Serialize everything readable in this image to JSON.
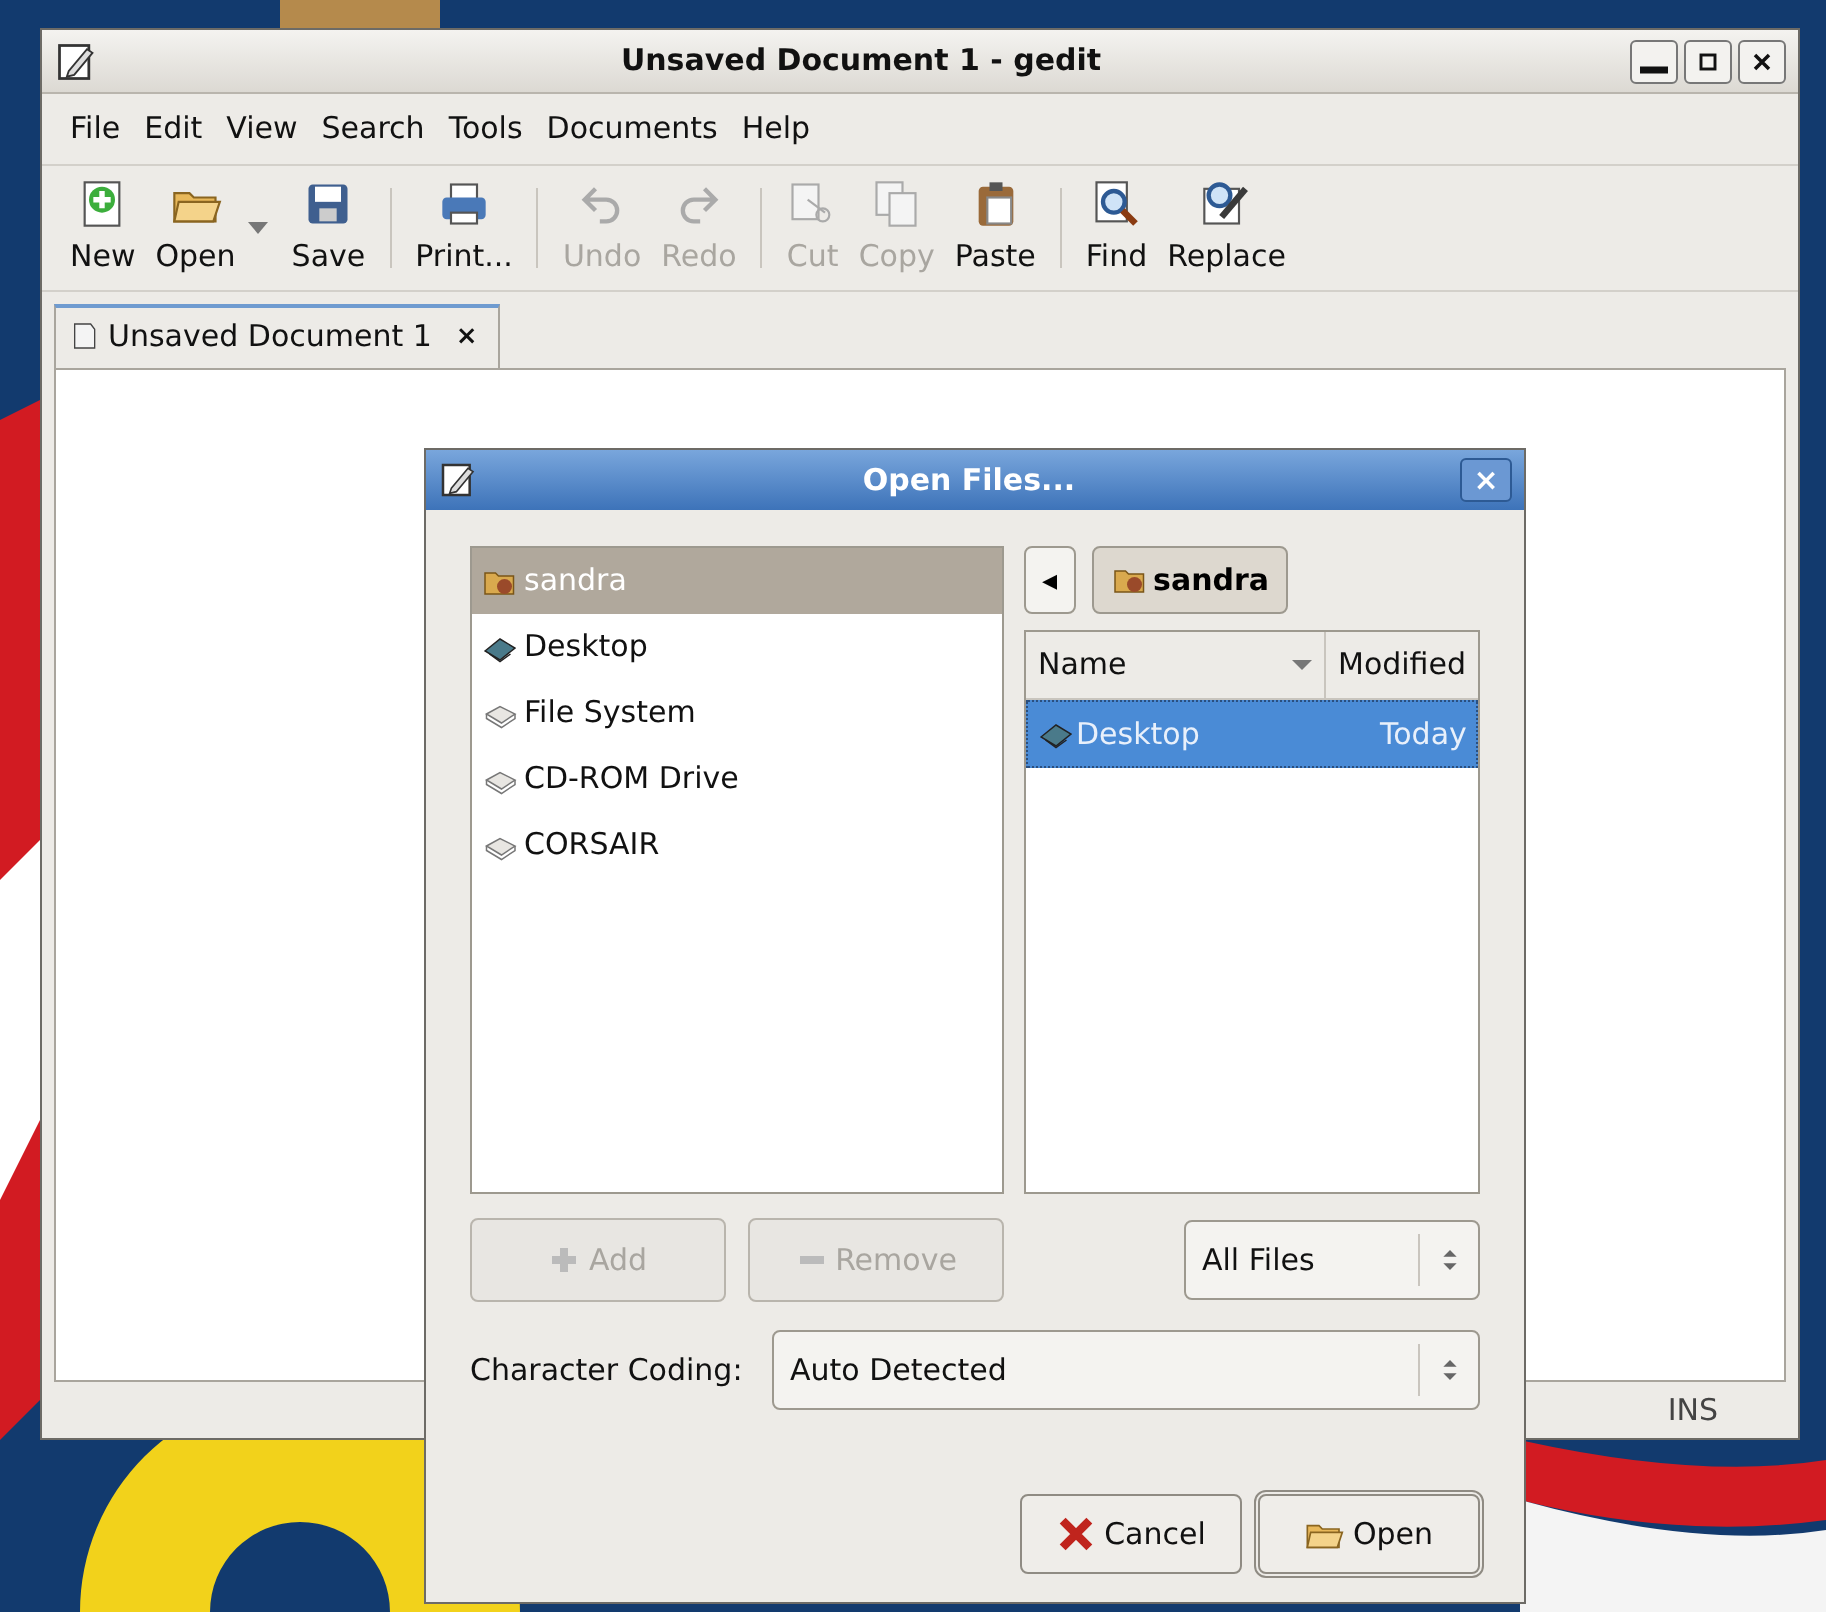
{
  "window": {
    "title": "Unsaved Document 1 - gedit"
  },
  "menu": [
    "File",
    "Edit",
    "View",
    "Search",
    "Tools",
    "Documents",
    "Help"
  ],
  "toolbar": [
    {
      "kind": "button",
      "label": "New",
      "disabled": false
    },
    {
      "kind": "button",
      "label": "Open",
      "disabled": false,
      "dropdown": true
    },
    {
      "kind": "button",
      "label": "Save",
      "disabled": false
    },
    {
      "kind": "separator"
    },
    {
      "kind": "button",
      "label": "Print...",
      "disabled": false
    },
    {
      "kind": "separator"
    },
    {
      "kind": "button",
      "label": "Undo",
      "disabled": true
    },
    {
      "kind": "button",
      "label": "Redo",
      "disabled": true
    },
    {
      "kind": "separator"
    },
    {
      "kind": "button",
      "label": "Cut",
      "disabled": true
    },
    {
      "kind": "button",
      "label": "Copy",
      "disabled": true
    },
    {
      "kind": "button",
      "label": "Paste",
      "disabled": false
    },
    {
      "kind": "separator"
    },
    {
      "kind": "button",
      "label": "Find",
      "disabled": false
    },
    {
      "kind": "button",
      "label": "Replace",
      "disabled": false
    }
  ],
  "tabs": [
    {
      "label": "Unsaved Document 1",
      "close": "×",
      "selected": true
    }
  ],
  "status_bar": {
    "mode": "INS"
  },
  "dialog": {
    "title": "Open Files...",
    "close": "×",
    "places": [
      {
        "label": "sandra",
        "selected": true
      },
      {
        "label": "Desktop",
        "selected": false
      },
      {
        "label": "File System",
        "selected": false
      },
      {
        "label": "CD-ROM Drive",
        "selected": false
      },
      {
        "label": "CORSAIR",
        "selected": false
      }
    ],
    "path": {
      "back": "◂",
      "crumb": "sandra"
    },
    "columns": [
      "Name",
      "Modified"
    ],
    "files": [
      {
        "name": "Desktop",
        "modified": "Today",
        "selected": true
      }
    ],
    "add_button": {
      "label": "Add",
      "disabled": true
    },
    "remove_button": {
      "label": "Remove",
      "disabled": true
    },
    "filter": {
      "value": "All Files"
    },
    "coding": {
      "label": "Character Coding:",
      "value": "Auto Detected"
    },
    "buttons": [
      {
        "kind": "cancel",
        "label": "Cancel"
      },
      {
        "kind": "open",
        "label": "Open"
      }
    ]
  }
}
